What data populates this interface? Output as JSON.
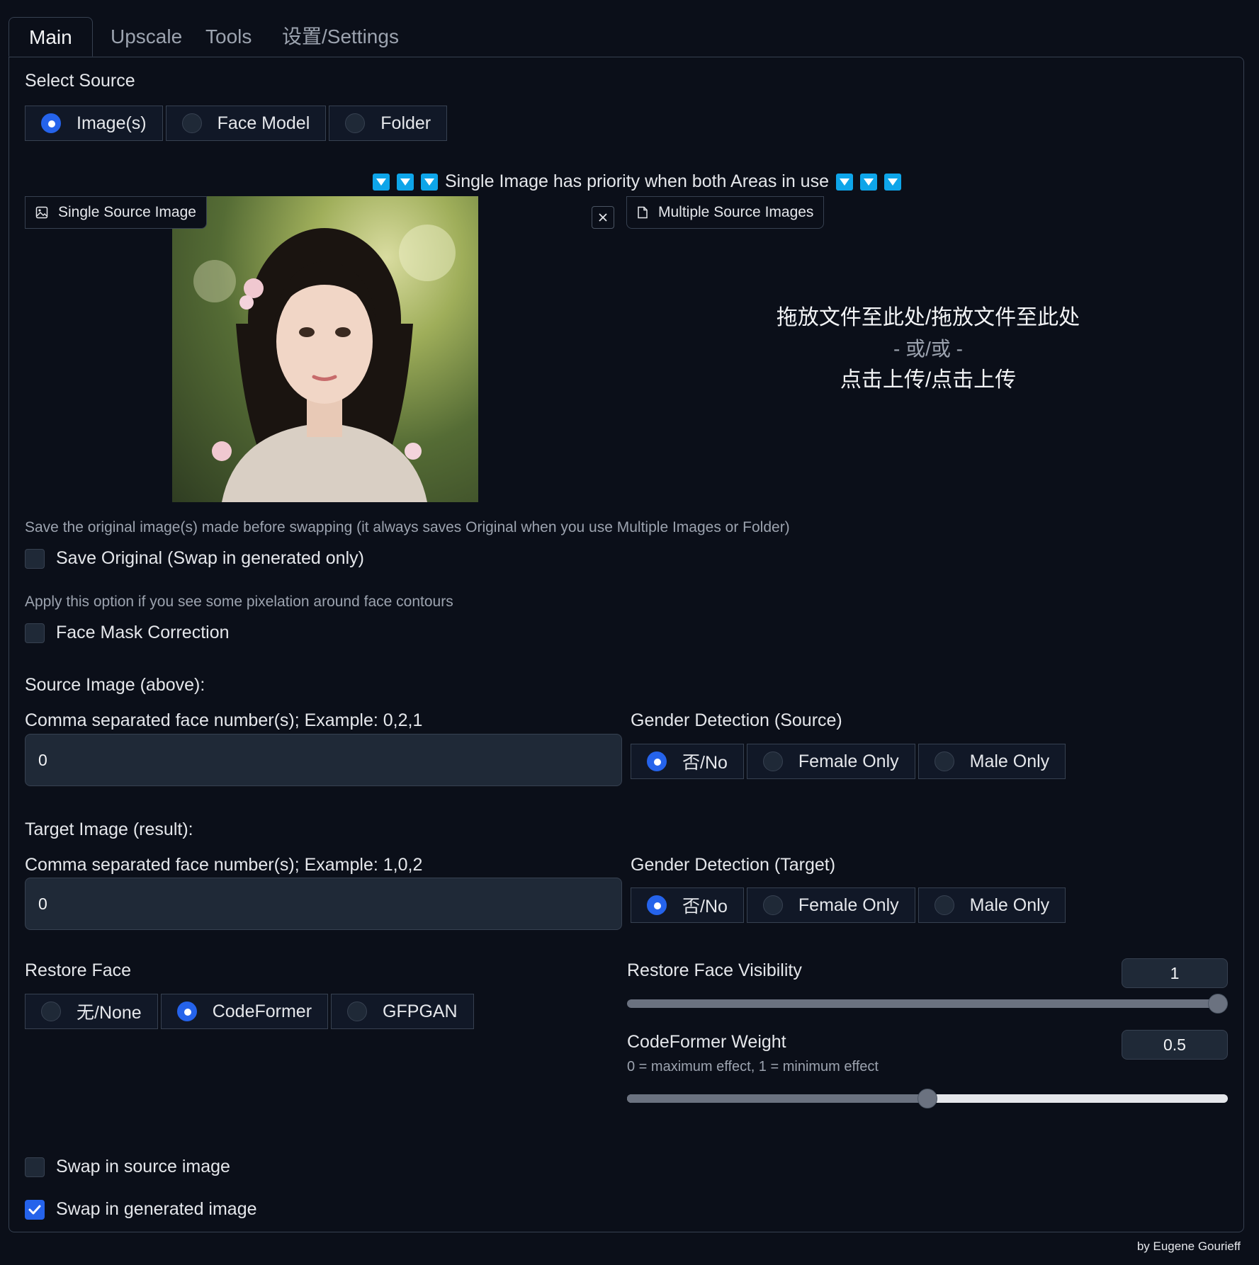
{
  "tabs": [
    {
      "label": "Main",
      "active": true
    },
    {
      "label": "Upscale",
      "active": false
    },
    {
      "label": "Tools",
      "active": false
    },
    {
      "label": "设置/Settings",
      "active": false
    }
  ],
  "select_source": {
    "label": "Select Source",
    "options": [
      {
        "label": "Image(s)",
        "selected": true
      },
      {
        "label": "Face Model",
        "selected": false
      },
      {
        "label": "Folder",
        "selected": false
      }
    ]
  },
  "priority_notice": "Single Image has priority when both Areas in use",
  "single_source": {
    "label": "Single Source Image",
    "image_icon": "image-icon"
  },
  "multiple_source": {
    "label": "Multiple Source Images",
    "drop_text": "拖放文件至此处/拖放文件至此处",
    "or_text": "- 或/或 -",
    "click_text": "点击上传/点击上传"
  },
  "save_original": {
    "info": "Save the original image(s) made before swapping (it always saves Original when you use Multiple Images or Folder)",
    "label": "Save Original (Swap in generated only)",
    "checked": false
  },
  "face_mask": {
    "info": "Apply this option if you see some pixelation around face contours",
    "label": "Face Mask Correction",
    "checked": false
  },
  "source_image": {
    "heading": "Source Image (above):",
    "faces_label": "Comma separated face number(s); Example: 0,2,1",
    "faces_value": "0",
    "gender_label": "Gender Detection (Source)",
    "gender_options": [
      {
        "label": "否/No",
        "selected": true
      },
      {
        "label": "Female Only",
        "selected": false
      },
      {
        "label": "Male Only",
        "selected": false
      }
    ]
  },
  "target_image": {
    "heading": "Target Image (result):",
    "faces_label": "Comma separated face number(s); Example: 1,0,2",
    "faces_value": "0",
    "gender_label": "Gender Detection (Target)",
    "gender_options": [
      {
        "label": "否/No",
        "selected": true
      },
      {
        "label": "Female Only",
        "selected": false
      },
      {
        "label": "Male Only",
        "selected": false
      }
    ]
  },
  "restore_face": {
    "label": "Restore Face",
    "options": [
      {
        "label": "无/None",
        "selected": false
      },
      {
        "label": "CodeFormer",
        "selected": true
      },
      {
        "label": "GFPGAN",
        "selected": false
      }
    ]
  },
  "restore_visibility": {
    "label": "Restore Face Visibility",
    "value": "1",
    "fraction": 1.0
  },
  "codeformer_weight": {
    "label": "CodeFormer Weight",
    "info": "0 = maximum effect, 1 = minimum effect",
    "value": "0.5",
    "fraction": 0.5
  },
  "swap_source": {
    "label": "Swap in source image",
    "checked": false
  },
  "swap_generated": {
    "label": "Swap in generated image",
    "checked": true
  },
  "footer": "by Eugene Gourieff",
  "colors": {
    "accent": "#2563eb",
    "background": "#0b0f19",
    "border": "#374151",
    "notice_icon": "#0ea5e9"
  }
}
